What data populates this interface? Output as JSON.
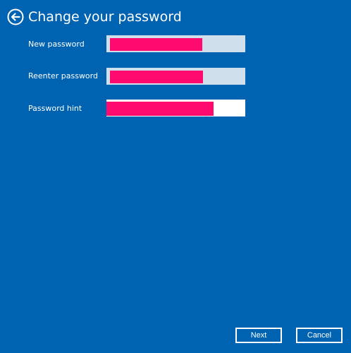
{
  "header": {
    "title": "Change your password",
    "back_icon": "back-arrow-icon"
  },
  "form": {
    "new_password": {
      "label": "New password",
      "value_state": "redacted"
    },
    "reenter_password": {
      "label": "Reenter password",
      "value_state": "redacted"
    },
    "password_hint": {
      "label": "Password hint",
      "value_state": "redacted",
      "focused": true
    }
  },
  "buttons": {
    "next_label": "Next",
    "cancel_label": "Cancel"
  },
  "colors": {
    "background": "#0063B1",
    "input_inactive": "#D0DFEC",
    "input_active": "#FFFFFF",
    "redaction": "#FF0A6E",
    "text": "#FFFFFF"
  }
}
